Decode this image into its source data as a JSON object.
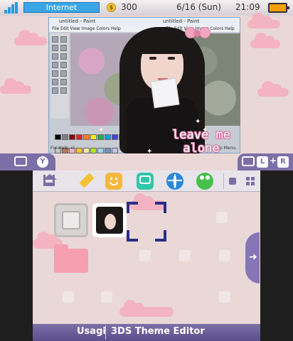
{
  "top_bar": {
    "network": "Internet",
    "coins": "300",
    "date": "6/16 (Sun)",
    "time": "21:09"
  },
  "wallpaper": {
    "paint_title": "untitled - Paint",
    "paint_menu": "File   Edit   View   Image   Colors   Help",
    "paint_title_right": "untitled - Paint",
    "paint_menu_right": "File   Edit   View   Image   Colors   Help",
    "help_text": "For Help, cl",
    "help_menu": "Help Menu.",
    "caption_line1": "leave me",
    "caption_line2": "alone"
  },
  "top_tabs": {
    "left_button": "Y",
    "right_text_l": "L",
    "right_plus": "+",
    "right_text_r": "R"
  },
  "bottom_toolbar": {
    "icons": [
      "home-settings-icon",
      "pencil-icon",
      "smiley-icon",
      "chat-icon",
      "globe-icon",
      "people-icon",
      "view-toggle-icon",
      "grid-icon"
    ]
  },
  "footer": {
    "author": "Usagi",
    "title": "3DS Theme Editor"
  },
  "colors": {
    "background": "#ead8d7",
    "accent": "#7b6fa7",
    "cloud": "#f4b3c0",
    "cursor": "#2a2e88",
    "folder": "#f59fb1"
  }
}
